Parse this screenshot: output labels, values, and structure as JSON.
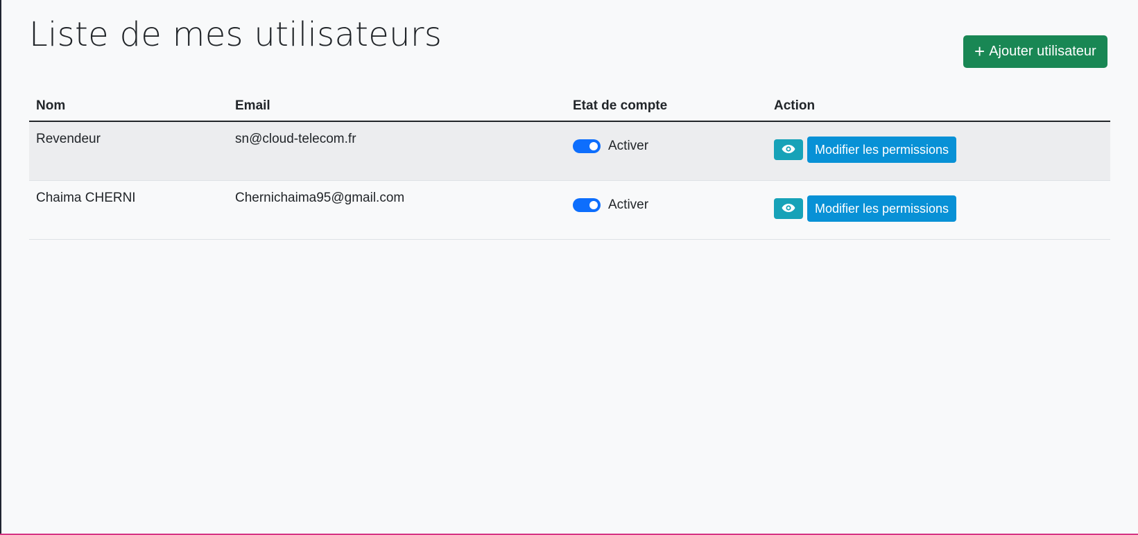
{
  "page": {
    "title": "Liste de mes utilisateurs"
  },
  "toolbar": {
    "add_icon": "+",
    "add_label": "Ajouter utilisateur"
  },
  "table": {
    "headers": {
      "nom": "Nom",
      "email": "Email",
      "etat": "Etat de compte",
      "action": "Action"
    },
    "rows": [
      {
        "nom": "Revendeur",
        "email": "sn@cloud-telecom.fr",
        "status_label": "Activer",
        "active": true,
        "permissions_label": "Modifier les permissions",
        "view_icon": "eye-icon"
      },
      {
        "nom": "Chaima CHERNI",
        "email": "Chernichaima95@gmail.com",
        "status_label": "Activer",
        "active": true,
        "permissions_label": "Modifier les permissions",
        "view_icon": "eye-icon"
      }
    ]
  },
  "colors": {
    "add_button": "#198754",
    "toggle_on": "#0d6efd",
    "view_button": "#17a2b8",
    "permissions_button": "#0891d6"
  }
}
